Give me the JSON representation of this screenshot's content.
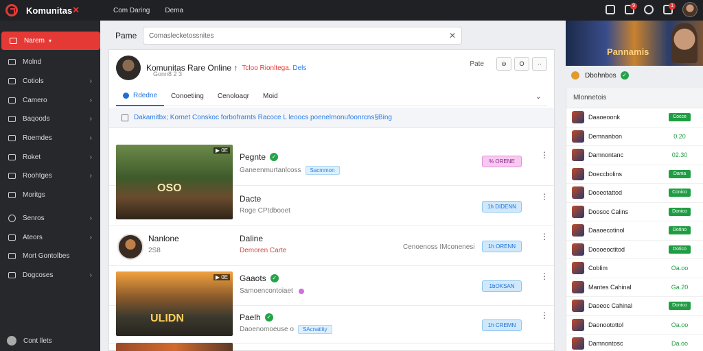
{
  "topbar": {
    "logo_text": "Komunitas",
    "logo_mark": "✕",
    "nav": [
      "Com Daring",
      "Dema"
    ],
    "badges": [
      "9",
      "1"
    ]
  },
  "sidebar": {
    "active_label": "Narem",
    "items": [
      {
        "label": "Molnd",
        "chevron": false
      },
      {
        "label": "Cotiols",
        "chevron": true
      },
      {
        "label": "Camero",
        "chevron": true
      },
      {
        "label": "Baqoods",
        "chevron": true
      },
      {
        "label": "Roemdes",
        "chevron": true
      },
      {
        "label": "Roket",
        "chevron": true
      },
      {
        "label": "Roohtges",
        "chevron": true
      },
      {
        "label": "Moritgs",
        "chevron": false
      },
      {
        "label": "Senros",
        "chevron": true
      },
      {
        "label": "Ateors",
        "chevron": true
      },
      {
        "label": "Mort Gontolbes",
        "chevron": false
      },
      {
        "label": "Dogcoses",
        "chevron": true
      }
    ],
    "bottom_label": "Cont llets"
  },
  "search": {
    "title": "Pame",
    "placeholder": "Comaslecketossnites"
  },
  "channel": {
    "title": "Komunitas Rare Online ↑",
    "links_red": "Tcloo Rionltega.",
    "links_blue": "Dels",
    "subtitle": "Gonn8 2 3",
    "actions_label": "Pate",
    "action_icons": [
      "⊖",
      "O",
      "··"
    ]
  },
  "tabs": [
    "Rdedne",
    "Conoetiing",
    "Cenoloaqr",
    "Moid"
  ],
  "notice": "Dakamitbx; Kornet Conskoc forbofrarnts  Racoce L leoocs poenelmonufoonrcns§Bing",
  "rows": [
    {
      "title": "Pegnte",
      "verified": true,
      "sub": "Ganeenmurtanlcoss",
      "chip": "Sacmmon",
      "pill": "% ORENE",
      "pill_style": "pink",
      "thumb_badge": "▶ 0E",
      "thumb_text": "OSO"
    },
    {
      "title": "Dacte",
      "verified": false,
      "sub": "Roge  CPtdbooet",
      "pill": "1h DIDENN"
    },
    {
      "title": "Nanlone",
      "verified": false,
      "sub": "2S8",
      "mid_title": "Daline",
      "mid_sub": "Demoren Carte",
      "right_text": "Cenoenoss IMconenesi",
      "pill": "1h ORENN"
    },
    {
      "title": "Gaaots",
      "verified": true,
      "sub": "Samoencontoiaet",
      "pink_dot": true,
      "pill": "1bOKSAN",
      "thumb_badge": "▶ 0E",
      "thumb_text": "ULIDN"
    },
    {
      "title": "Paelh",
      "verified": true,
      "sub": "Daoenomoeuse o",
      "chip": "SAcnatlity",
      "pill": "1h CREMN"
    }
  ],
  "right": {
    "banner_text": "Pannamis",
    "channel_name": "Dbohnbos",
    "list_title": "Mlonnetois",
    "items": [
      {
        "name": "Daaoeoonk",
        "badge": "Cocce",
        "style": "solid"
      },
      {
        "name": "Demnanbon",
        "badge": "0.20",
        "style": "text"
      },
      {
        "name": "Damnontanc",
        "badge": "02.30",
        "style": "text"
      },
      {
        "name": "Doeccbolins",
        "badge": "Dania",
        "style": "solid"
      },
      {
        "name": "Dooeotattod",
        "badge": "Conico",
        "style": "solid"
      },
      {
        "name": "Doosoc Calins",
        "badge": "Donico",
        "style": "solid"
      },
      {
        "name": "Daaoecotinol",
        "badge": "Dotino",
        "style": "solid"
      },
      {
        "name": "Doooeoctitod",
        "badge": "Dotico",
        "style": "solid"
      },
      {
        "name": "Coblim",
        "badge": "Oa.oo",
        "style": "text"
      },
      {
        "name": "Mantes Cahinal",
        "badge": "Ga.20",
        "style": "text"
      },
      {
        "name": "Daoeoc Cahinal",
        "badge": "Donico",
        "style": "solid"
      },
      {
        "name": "Daonootottol",
        "badge": "Oa.oo",
        "style": "text"
      },
      {
        "name": "Damnontosc",
        "badge": "Da.oo",
        "style": "text"
      }
    ]
  },
  "colors": {
    "accent": "#e53935",
    "link": "#1d6fd8",
    "success": "#1f9d43"
  }
}
